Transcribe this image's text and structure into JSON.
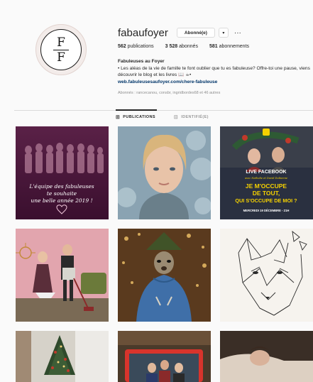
{
  "profile": {
    "username": "fabaufoyer",
    "avatar_letters": [
      "F",
      "F"
    ],
    "follow_button_label": "Abonné(e)",
    "dropdown_label": "▾",
    "more_label": "···",
    "stats": {
      "posts": "562",
      "posts_label": "publications",
      "followers": "3 528",
      "followers_label": "abonnés",
      "following": "581",
      "following_label": "abonnements"
    },
    "bio": {
      "name": "Fabuleuses au Foyer",
      "text": "• Les aléas de la vie de famille te font oublier que tu es fabuleuse? Offre-toi une pause, viens découvrir le blog et les livres 📖 ☕•",
      "link": "web.fabuleusesaufoyer.com/chere-fabuleuse"
    },
    "followed_by": "Abonnés : rancecanou, consbr, ingridbordes68 et 46 autres"
  },
  "tabs": [
    {
      "label": "PUBLICATIONS",
      "icon": "grid-icon",
      "active": true
    },
    {
      "label": "IDENTIFIÉ(E)",
      "icon": "tag-icon",
      "active": false
    }
  ],
  "posts": [
    {
      "id": 1,
      "caption": "L'équipe des fabuleuses\nte souhaite\nune belle année 2019 !",
      "heart": "♡"
    },
    {
      "id": 2
    },
    {
      "id": 3,
      "lines": [
        "LIVE FACEBOOK",
        "avec Nathalie et David Dubienne",
        "JE M'OCCUPE",
        "DE TOUT,",
        "QUI S'OCCUPE DE MOI ?",
        "MERCREDI 19 DÉCEMBRE - 21H"
      ]
    },
    {
      "id": 4
    },
    {
      "id": 5
    },
    {
      "id": 6
    },
    {
      "id": 7
    },
    {
      "id": 8
    },
    {
      "id": 9
    }
  ],
  "colors": {
    "link": "#003569",
    "accent_yellow": "#f5d100",
    "post1_bg": "#4a1838",
    "post3_bg": "#1f2a44"
  }
}
